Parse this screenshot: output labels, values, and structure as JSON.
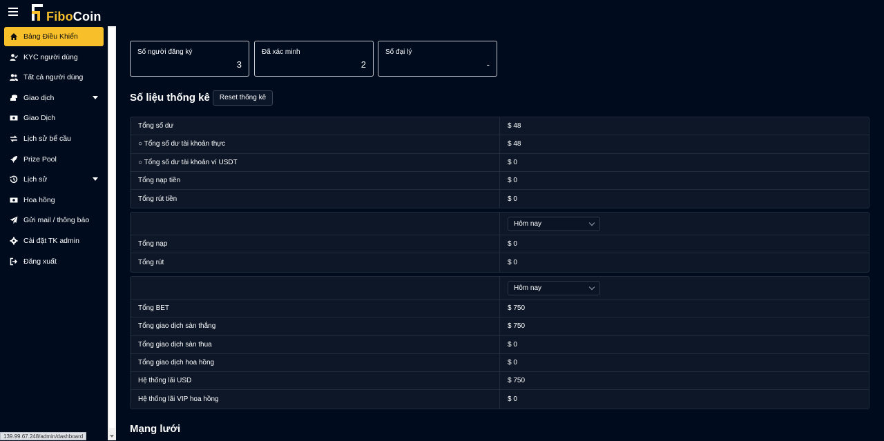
{
  "brand": {
    "part1": "Fibo",
    "part2": "Coin",
    "accent": "#f7bf2a"
  },
  "sidebar": {
    "items": [
      {
        "label": "Bảng Điều Khiển",
        "icon": "home-icon",
        "active": true
      },
      {
        "label": "KYC người dùng",
        "icon": "user-check-icon"
      },
      {
        "label": "Tất cả người dùng",
        "icon": "users-icon"
      },
      {
        "label": "Giao dịch",
        "icon": "coins-icon",
        "has_caret": true
      },
      {
        "label": "Giao Dịch",
        "icon": "money-bill-icon"
      },
      {
        "label": "Lịch sử bể cầu",
        "icon": "exchange-icon"
      },
      {
        "label": "Prize Pool",
        "icon": "rocket-icon"
      },
      {
        "label": "Lịch sử",
        "icon": "history-icon",
        "has_caret": true
      },
      {
        "label": "Hoa hồng",
        "icon": "money-bill-icon"
      },
      {
        "label": "Gửi mail / thông báo",
        "icon": "send-icon"
      },
      {
        "label": "Cài đặt TK admin",
        "icon": "gear-icon"
      },
      {
        "label": "Đăng xuất",
        "icon": "logout-icon"
      }
    ]
  },
  "cards": [
    {
      "label": "Số người đăng ký",
      "value": "3"
    },
    {
      "label": "Đã xác minh",
      "value": "2"
    },
    {
      "label": "Số đại lý",
      "value": "-"
    }
  ],
  "stats": {
    "title": "Số liệu thống kê",
    "reset_label": "Reset thống kê",
    "table1": [
      {
        "label": "Tổng số dư",
        "value": "$ 48"
      },
      {
        "label": "○ Tổng số dư tài khoản thực",
        "value": "$ 48"
      },
      {
        "label": "○ Tổng số dư tài khoản ví USDT",
        "value": "$ 0"
      },
      {
        "label": "Tổng nạp tiền",
        "value": "$ 0"
      },
      {
        "label": "Tổng rút tiền",
        "value": "$ 0"
      }
    ],
    "table2": {
      "select_value": "Hôm nay",
      "rows": [
        {
          "label": "Tổng nạp",
          "value": "$ 0"
        },
        {
          "label": "Tổng rút",
          "value": "$ 0"
        }
      ]
    },
    "table3": {
      "select_value": "Hôm nay",
      "rows": [
        {
          "label": "Tổng BET",
          "value": "$ 750"
        },
        {
          "label": "Tổng giao dịch sàn thắng",
          "value": "$ 750"
        },
        {
          "label": "Tổng giao dịch sàn thua",
          "value": "$ 0"
        },
        {
          "label": "Tổng giao dịch hoa hồng",
          "value": "$ 0"
        },
        {
          "label": "Hệ thống lãi USD",
          "value": "$ 750"
        },
        {
          "label": "Hệ thống lãi VIP hoa hồng",
          "value": "$ 0"
        }
      ]
    }
  },
  "network_title": "Mạng lưới",
  "status_url": "139.99.67.248/admin/dashboard"
}
